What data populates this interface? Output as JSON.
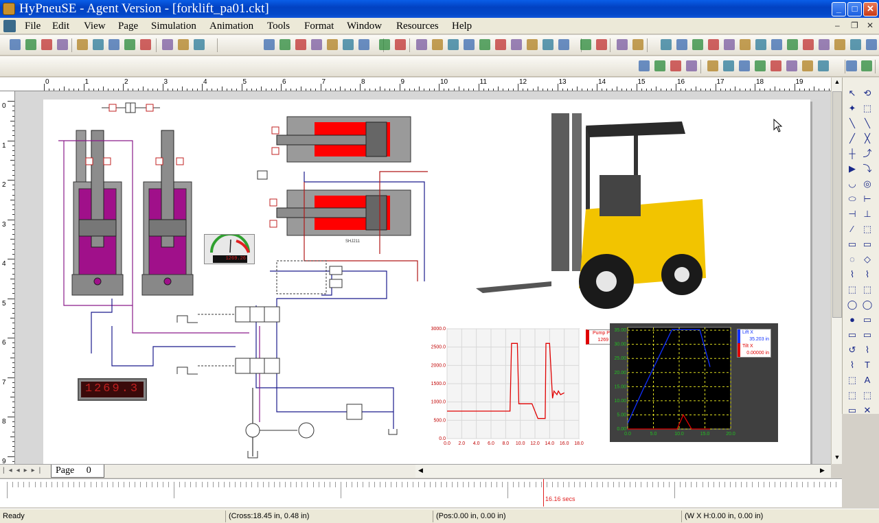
{
  "window": {
    "title": "HyPneuSE - Agent Version - [forklift_pa01.ckt]",
    "minimize": "_",
    "maximize": "□",
    "close": "✕"
  },
  "menu": [
    {
      "label": "File"
    },
    {
      "label": "Edit"
    },
    {
      "label": "View"
    },
    {
      "label": "Page"
    },
    {
      "label": "Simulation"
    },
    {
      "label": "Animation"
    },
    {
      "label": "Tools"
    },
    {
      "label": "Format"
    },
    {
      "label": "Window"
    },
    {
      "label": "Resources"
    },
    {
      "label": "Help"
    }
  ],
  "ruler": {
    "h_ticks": [
      "0",
      "1",
      "2",
      "3",
      "4",
      "5",
      "6",
      "7",
      "8",
      "9",
      "10",
      "11",
      "12",
      "13",
      "14",
      "15",
      "16",
      "17",
      "18",
      "19"
    ],
    "v_ticks": [
      "0",
      "1",
      "2",
      "3",
      "4",
      "5",
      "6",
      "7",
      "8",
      "9"
    ]
  },
  "circuit": {
    "gauge_readout": "1269.26",
    "digital_display": "1269.3",
    "tilt_cylinder_label": "SHJ211"
  },
  "pressure_chart": {
    "legend": [
      {
        "name": "Pump P",
        "value": "1269",
        "color": "#e00000"
      }
    ],
    "chart_data": {
      "type": "line",
      "x_ticks": [
        "0.0",
        "2.0",
        "4.0",
        "6.0",
        "8.0",
        "10.0",
        "12.0",
        "14.0",
        "16.0",
        "18.0"
      ],
      "y_ticks": [
        "0.0",
        "500.0",
        "1000.0",
        "1500.0",
        "2000.0",
        "2500.0",
        "3000.0"
      ],
      "xlim": [
        0,
        18
      ],
      "ylim": [
        0,
        3000
      ],
      "series": [
        {
          "name": "Pump P",
          "color": "#e00000",
          "x": [
            0,
            7.5,
            8.6,
            8.8,
            9.6,
            9.8,
            11.6,
            12.4,
            13.4,
            13.5,
            14.0,
            14.4,
            14.6,
            15.0,
            15.2,
            15.5,
            16.0
          ],
          "y": [
            750,
            750,
            750,
            2600,
            2600,
            950,
            950,
            550,
            550,
            2600,
            2600,
            1100,
            1300,
            1200,
            1300,
            1200,
            1250
          ]
        }
      ]
    }
  },
  "position_chart": {
    "legend": [
      {
        "name": "Lift X",
        "value": "35.203 in",
        "color": "#1030ff"
      },
      {
        "name": "Tilt X",
        "value": "0.00000 in",
        "color": "#e00000"
      }
    ],
    "chart_data": {
      "type": "line",
      "x_ticks": [
        "0.0",
        "5.0",
        "10.0",
        "15.0",
        "20.0"
      ],
      "y_ticks": [
        "0.00",
        "5.00",
        "10.00",
        "15.00",
        "20.00",
        "25.00",
        "30.00",
        "35.00"
      ],
      "xlim": [
        0,
        20
      ],
      "ylim": [
        0,
        36
      ],
      "series": [
        {
          "name": "Lift X",
          "color": "#1030ff",
          "x": [
            0,
            3,
            8.6,
            14,
            16
          ],
          "y": [
            2,
            14,
            35.2,
            35.2,
            22
          ]
        },
        {
          "name": "Tilt X",
          "color": "#e00000",
          "x": [
            0,
            9.6,
            10.8,
            12.4,
            16
          ],
          "y": [
            0,
            0,
            5,
            0,
            0
          ]
        }
      ]
    }
  },
  "tabs": {
    "page_label": "Page",
    "page_number": "0"
  },
  "timeline": {
    "time_label": "16.16 secs"
  },
  "status": {
    "ready": "Ready",
    "cross": "(Cross:18.45 in, 0.48 in)",
    "pos": "(Pos:0.00 in, 0.00 in)",
    "size": "(W X H:0.00 in, 0.00 in)"
  },
  "colors": {
    "hydraulic_fill": "#a0108a",
    "tilt_fill": "#ff0000",
    "line_blue": "#1a1a8c",
    "line_red": "#b01818",
    "line_purple": "#8a1a8a"
  }
}
